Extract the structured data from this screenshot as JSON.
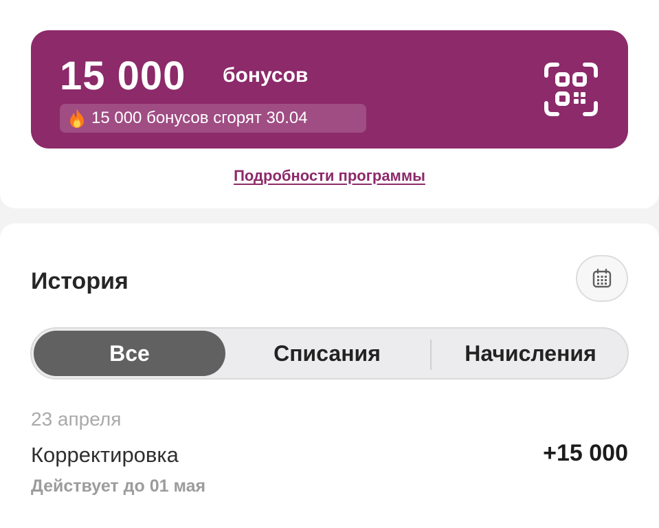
{
  "bonus_card": {
    "amount": "15 000",
    "unit": "бонусов",
    "expiry_text": "15 000 бонусов сгорят 30.04",
    "background_color": "#8c2a6a",
    "fire_icon": "fire-icon",
    "qr_icon": "qr-code-icon"
  },
  "program_details_link": "Подробности программы",
  "history": {
    "title": "История",
    "calendar_icon": "calendar-icon",
    "tabs": [
      {
        "label": "Все",
        "active": true
      },
      {
        "label": "Списания",
        "active": false
      },
      {
        "label": "Начисления",
        "active": false
      }
    ],
    "groups": [
      {
        "date": "23 апреля",
        "items": [
          {
            "title": "Корректировка",
            "amount": "+15 000",
            "subtitle": "Действует до 01 мая"
          }
        ]
      }
    ]
  }
}
